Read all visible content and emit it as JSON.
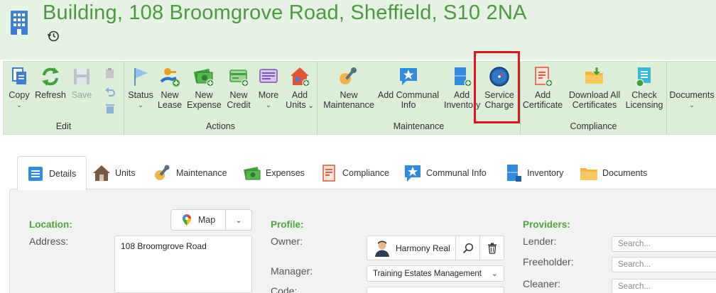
{
  "header": {
    "title": "Building, 108 Broomgrove Road, Sheffield, S10 2NA",
    "title_icon": "building-icon",
    "history_icon": "history-icon"
  },
  "ribbon": {
    "edit": {
      "label": "Edit",
      "copy": {
        "line1": "Copy",
        "icon": "copy-icon"
      },
      "refresh": {
        "line1": "Refresh",
        "icon": "refresh-icon"
      },
      "save": {
        "line1": "Save",
        "icon": "save-icon"
      }
    },
    "actions": {
      "label": "Actions",
      "status": {
        "line1": "Status",
        "icon": "flag-icon"
      },
      "new_lease": {
        "line1": "New",
        "line2": "Lease",
        "icon": "key-hand-icon"
      },
      "new_expense": {
        "line1": "New",
        "line2": "Expense",
        "icon": "money-icon"
      },
      "new_credit": {
        "line1": "New",
        "line2": "Credit",
        "icon": "credit-icon"
      },
      "more": {
        "line1": "More",
        "icon": "more-icon"
      },
      "add_units": {
        "line1": "Add",
        "line2": "Units",
        "icon": "house-add-icon"
      }
    },
    "maintenance": {
      "label": "Maintenance",
      "new_maintenance": {
        "line1": "New",
        "line2": "Maintenance",
        "icon": "wrench-icon"
      },
      "add_communal_info": {
        "line1": "Add Communal",
        "line2": "Info",
        "icon": "star-chat-icon"
      },
      "add_inventory": {
        "line1": "Add",
        "line2": "Inventory",
        "icon": "inventory-icon"
      },
      "service_charge": {
        "line1": "Service",
        "line2": "Charge",
        "icon": "gauge-icon"
      }
    },
    "compliance": {
      "label": "Compliance",
      "add_certificate": {
        "line1": "Add",
        "line2": "Certificate",
        "icon": "certificate-icon"
      },
      "download_all_certificates": {
        "line1": "Download All",
        "line2": "Certificates",
        "icon": "folder-download-icon"
      },
      "check_licensing": {
        "line1": "Check",
        "line2": "Licensing",
        "icon": "licensing-icon"
      }
    },
    "documents": {
      "line1": "Documents"
    }
  },
  "tabs": [
    {
      "label": "Details",
      "icon": "details-icon"
    },
    {
      "label": "Units",
      "icon": "house-icon"
    },
    {
      "label": "Maintenance",
      "icon": "wrench-icon"
    },
    {
      "label": "Expenses",
      "icon": "money-icon"
    },
    {
      "label": "Compliance",
      "icon": "certificate-icon"
    },
    {
      "label": "Communal Info",
      "icon": "star-chat-icon"
    },
    {
      "label": "Inventory",
      "icon": "inventory-icon"
    },
    {
      "label": "Documents",
      "icon": "folder-icon"
    }
  ],
  "details": {
    "location_label": "Location:",
    "address_label": "Address:",
    "address_value": "108 Broomgrove Road",
    "map_label": "Map",
    "profile_label": "Profile:",
    "owner_label": "Owner:",
    "owner_value": "Harmony Real",
    "manager_label": "Manager:",
    "manager_value": "Training Estates Management",
    "code_label": "Code:",
    "providers_label": "Providers:",
    "lender_label": "Lender:",
    "freeholder_label": "Freeholder:",
    "cleaner_label": "Cleaner:",
    "search_placeholder": "Search..."
  },
  "colors": {
    "accent_green": "#4c9a40",
    "header_bg": "#e6f2e3",
    "ribbon_bg": "#dcedd8",
    "highlight_red": "#e0141e"
  }
}
